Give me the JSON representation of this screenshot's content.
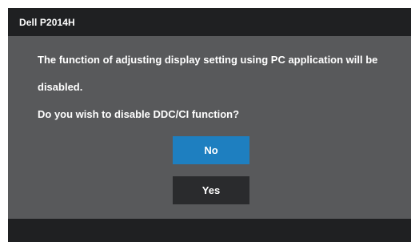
{
  "window": {
    "title": "Dell P2014H"
  },
  "dialog": {
    "message_line1": "The function of adjusting display setting using PC application will be",
    "message_line2": "disabled.",
    "question": "Do you wish to disable DDC/CI function?"
  },
  "buttons": {
    "no_label": "No",
    "yes_label": "Yes",
    "selected": "No"
  },
  "colors": {
    "titlebar": "#1f2022",
    "panel": "#58595b",
    "selected_button": "#1e7fc0",
    "button": "#2a2b2d",
    "text": "#ffffff"
  }
}
